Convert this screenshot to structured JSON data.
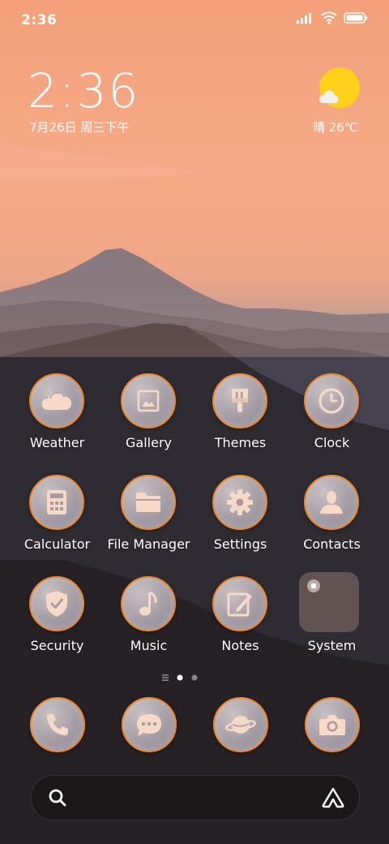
{
  "status_bar": {
    "time": "2:36"
  },
  "clock_widget": {
    "time": "2:36",
    "date": "7月26日 周三下午"
  },
  "weather_widget": {
    "text": "晴 26℃",
    "icon": "partly-sunny-icon"
  },
  "apps": [
    {
      "label": "Weather",
      "icon": "cloud-sun-icon"
    },
    {
      "label": "Gallery",
      "icon": "image-icon"
    },
    {
      "label": "Themes",
      "icon": "paintbrush-icon"
    },
    {
      "label": "Clock",
      "icon": "clock-icon"
    },
    {
      "label": "Calculator",
      "icon": "calculator-icon"
    },
    {
      "label": "File Manager",
      "icon": "folder-icon"
    },
    {
      "label": "Settings",
      "icon": "gear-icon"
    },
    {
      "label": "Contacts",
      "icon": "person-icon"
    },
    {
      "label": "Security",
      "icon": "shield-check-icon"
    },
    {
      "label": "Music",
      "icon": "music-note-icon"
    },
    {
      "label": "Notes",
      "icon": "edit-note-icon"
    },
    {
      "label": "System",
      "icon": "folder-group-icon"
    }
  ],
  "dock": [
    {
      "icon": "phone-icon"
    },
    {
      "icon": "message-icon"
    },
    {
      "icon": "planet-browser-icon"
    },
    {
      "icon": "camera-icon"
    }
  ],
  "colors": {
    "accent_ring": "#f0872d",
    "icon_glyph": "#f7d9c8",
    "sun": "#ffd11a"
  }
}
